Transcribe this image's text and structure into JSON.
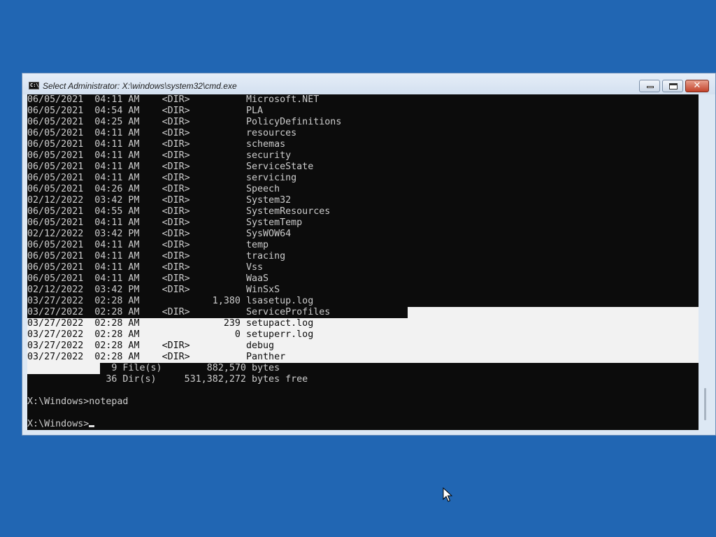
{
  "window": {
    "title": "Select Administrator: X:\\windows\\system32\\cmd.exe",
    "icon": "cmd-icon",
    "controls": {
      "minimize": "minimize-icon",
      "maximize": "maximize-icon",
      "close_glyph": "✕"
    }
  },
  "console": {
    "lines": [
      "06/05/2021  04:11 AM    <DIR>          Microsoft.NET",
      "06/05/2021  04:54 AM    <DIR>          PLA",
      "06/05/2021  04:25 AM    <DIR>          PolicyDefinitions",
      "06/05/2021  04:11 AM    <DIR>          resources",
      "06/05/2021  04:11 AM    <DIR>          schemas",
      "06/05/2021  04:11 AM    <DIR>          security",
      "06/05/2021  04:11 AM    <DIR>          ServiceState",
      "06/05/2021  04:11 AM    <DIR>          servicing",
      "06/05/2021  04:26 AM    <DIR>          Speech",
      "02/12/2022  03:42 PM    <DIR>          System32",
      "06/05/2021  04:55 AM    <DIR>          SystemResources",
      "06/05/2021  04:11 AM    <DIR>          SystemTemp",
      "02/12/2022  03:42 PM    <DIR>          SysWOW64",
      "06/05/2021  04:11 AM    <DIR>          temp",
      "06/05/2021  04:11 AM    <DIR>          tracing",
      "06/05/2021  04:11 AM    <DIR>          Vss",
      "06/05/2021  04:11 AM    <DIR>          WaaS",
      "02/12/2022  03:42 PM    <DIR>          WinSxS",
      "03/27/2022  02:28 AM             1,380 lsasetup.log",
      "03/27/2022  02:28 AM    <DIR>          ServiceProfiles",
      "03/27/2022  02:28 AM               239 setupact.log",
      "03/27/2022  02:28 AM                 0 setuperr.log",
      "03/27/2022  02:28 AM    <DIR>          debug",
      "03/27/2022  02:28 AM    <DIR>          Panther",
      "               9 File(s)        882,570 bytes",
      "              36 Dir(s)     531,382,272 bytes free",
      "",
      "X:\\Windows>notepad",
      "",
      "X:\\Windows>"
    ],
    "selected_line_indices": [
      20,
      21,
      22,
      23
    ]
  },
  "colors": {
    "desktop": "#2166b3",
    "console_bg": "#0c0c0c",
    "console_text": "#cccccc",
    "selection": "#f2f2f2"
  },
  "pointer": "mouse-pointer-icon"
}
